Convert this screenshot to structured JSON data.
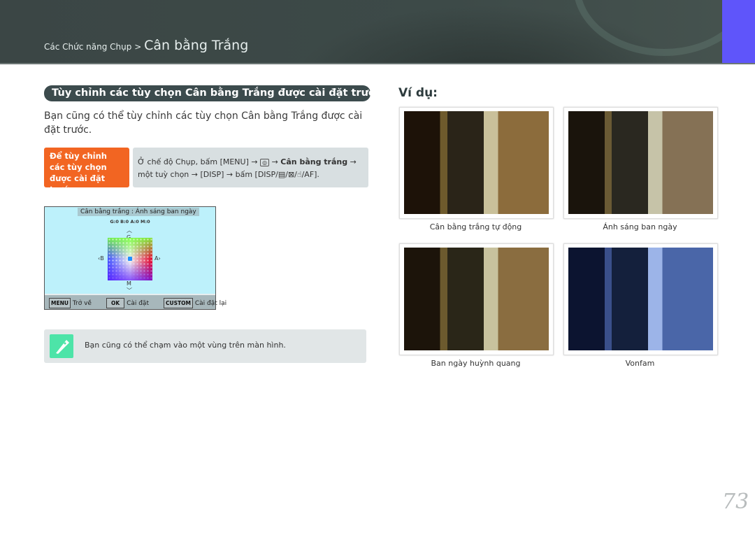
{
  "header": {
    "breadcrumb_parent": "Các Chức năng Chụp",
    "separator": ">",
    "title": "Cân bằng Trắng",
    "accent_color": "#5f55fa"
  },
  "section": {
    "heading": "Tùy chỉnh các tùy chọn Cân bằng Trắng được cài đặt trước",
    "body": "Bạn cũng có thể tùy chỉnh các tùy chọn Cân bằng Trắng được cài đặt trước."
  },
  "step": {
    "label": "Để tùy chỉnh các tùy chọn được cài đặt trước,",
    "line1_a": "Ở chế độ Chụp, bấm [MENU] → ",
    "camera_icon": "camera-icon",
    "line1_b": " → ",
    "bold": "Cân bằng trắng",
    "line1_c": " →",
    "line2": "một tuỳ chọn → [DISP] → bấm [DISP/▤/⊠/☝/AF]."
  },
  "screen": {
    "title": "Cân bằng trắng : Ánh sáng ban ngày",
    "values": "G:0 B:0 A:0 M:0",
    "axis_g": "G",
    "axis_b": "B",
    "axis_a": "A",
    "axis_m": "M",
    "menu_key": "MENU",
    "menu_label": "Trở về",
    "ok_key": "OK",
    "ok_label": "Cài đặt",
    "custom_key": "CUSTOM",
    "custom_label": "Cài đặt lại"
  },
  "note": {
    "icon": "pen-note-icon",
    "text": "Bạn cũng có thể chạm vào một vùng trên màn hình."
  },
  "examples": {
    "heading": "Ví dụ:",
    "captions": [
      "Cân bằng trắng tự động",
      "Ánh sáng ban ngày",
      "Ban ngày huỳnh quang",
      "Vonfam"
    ]
  },
  "page_number": "73"
}
